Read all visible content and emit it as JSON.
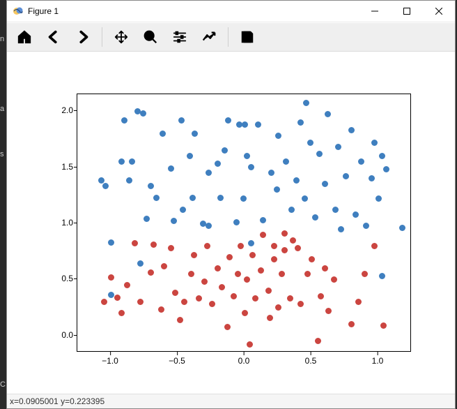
{
  "window": {
    "title": "Figure 1"
  },
  "toolbar": {
    "tools": [
      {
        "id": "home",
        "name": "home-icon"
      },
      {
        "id": "back",
        "name": "back-icon"
      },
      {
        "id": "forward",
        "name": "forward-icon"
      },
      {
        "sep": true
      },
      {
        "id": "pan",
        "name": "pan-icon"
      },
      {
        "id": "zoom",
        "name": "zoom-icon"
      },
      {
        "id": "config",
        "name": "sliders-icon"
      },
      {
        "id": "edit",
        "name": "line-chart-icon"
      },
      {
        "sep": true
      },
      {
        "id": "save",
        "name": "save-icon"
      }
    ]
  },
  "status": {
    "text": "x=0.0905001   y=0.223395"
  },
  "chart_data": {
    "type": "scatter",
    "xlim": [
      -1.25,
      1.25
    ],
    "ylim": [
      -0.15,
      2.15
    ],
    "xticks": [
      -1.0,
      -0.5,
      0.0,
      0.5,
      1.0
    ],
    "yticks": [
      0.0,
      0.5,
      1.0,
      1.5,
      2.0
    ],
    "xtick_labels": [
      "−1.0",
      "−0.5",
      "0.0",
      "0.5",
      "1.0"
    ],
    "ytick_labels": [
      "0.0",
      "0.5",
      "1.0",
      "1.5",
      "2.0"
    ],
    "series": [
      {
        "name": "blue",
        "color": "#3f7fbf",
        "points": [
          [
            -1.07,
            1.38
          ],
          [
            -1.04,
            1.33
          ],
          [
            -1.0,
            0.83
          ],
          [
            -1.0,
            0.36
          ],
          [
            -0.92,
            1.55
          ],
          [
            -0.9,
            1.92
          ],
          [
            -0.86,
            1.38
          ],
          [
            -0.84,
            1.55
          ],
          [
            -0.8,
            2.0
          ],
          [
            -0.78,
            0.64
          ],
          [
            -0.76,
            1.98
          ],
          [
            -0.73,
            1.04
          ],
          [
            -0.7,
            1.33
          ],
          [
            -0.66,
            1.23
          ],
          [
            -0.61,
            1.8
          ],
          [
            -0.55,
            1.49
          ],
          [
            -0.53,
            1.02
          ],
          [
            -0.47,
            1.92
          ],
          [
            -0.46,
            1.12
          ],
          [
            -0.41,
            1.6
          ],
          [
            -0.39,
            1.23
          ],
          [
            -0.37,
            1.8
          ],
          [
            -0.31,
            1.0
          ],
          [
            -0.27,
            1.45
          ],
          [
            -0.27,
            0.98
          ],
          [
            -0.2,
            1.53
          ],
          [
            -0.18,
            1.23
          ],
          [
            -0.15,
            1.65
          ],
          [
            -0.12,
            1.92
          ],
          [
            -0.06,
            1.01
          ],
          [
            -0.04,
            1.88
          ],
          [
            -0.01,
            1.22
          ],
          [
            0.0,
            1.88
          ],
          [
            0.02,
            1.6
          ],
          [
            0.05,
            1.5
          ],
          [
            0.05,
            0.82
          ],
          [
            0.1,
            1.88
          ],
          [
            0.14,
            1.03
          ],
          [
            0.2,
            1.45
          ],
          [
            0.24,
            1.3
          ],
          [
            0.25,
            1.78
          ],
          [
            0.31,
            1.55
          ],
          [
            0.35,
            1.12
          ],
          [
            0.39,
            1.38
          ],
          [
            0.42,
            1.9
          ],
          [
            0.45,
            1.22
          ],
          [
            0.46,
            2.07
          ],
          [
            0.49,
            1.72
          ],
          [
            0.53,
            1.05
          ],
          [
            0.56,
            1.62
          ],
          [
            0.6,
            1.35
          ],
          [
            0.62,
            1.97
          ],
          [
            0.68,
            1.12
          ],
          [
            0.7,
            1.68
          ],
          [
            0.72,
            0.95
          ],
          [
            0.76,
            1.42
          ],
          [
            0.8,
            1.83
          ],
          [
            0.83,
            1.08
          ],
          [
            0.87,
            1.55
          ],
          [
            0.91,
            0.98
          ],
          [
            0.95,
            1.4
          ],
          [
            0.97,
            1.72
          ],
          [
            1.0,
            1.22
          ],
          [
            1.03,
            0.53
          ],
          [
            1.03,
            1.6
          ],
          [
            1.06,
            1.48
          ],
          [
            1.18,
            0.96
          ]
        ]
      },
      {
        "name": "red",
        "color": "#cb4540",
        "points": [
          [
            -1.05,
            0.3
          ],
          [
            -1.0,
            0.52
          ],
          [
            -0.95,
            0.34
          ],
          [
            -0.92,
            0.2
          ],
          [
            -0.88,
            0.45
          ],
          [
            -0.82,
            0.82
          ],
          [
            -0.78,
            0.3
          ],
          [
            -0.7,
            0.56
          ],
          [
            -0.68,
            0.81
          ],
          [
            -0.62,
            0.23
          ],
          [
            -0.6,
            0.62
          ],
          [
            -0.55,
            0.78
          ],
          [
            -0.52,
            0.38
          ],
          [
            -0.48,
            0.14
          ],
          [
            -0.45,
            0.3
          ],
          [
            -0.4,
            0.55
          ],
          [
            -0.38,
            0.72
          ],
          [
            -0.34,
            0.33
          ],
          [
            -0.3,
            0.48
          ],
          [
            -0.28,
            0.8
          ],
          [
            -0.24,
            0.28
          ],
          [
            -0.2,
            0.6
          ],
          [
            -0.17,
            0.43
          ],
          [
            -0.13,
            0.08
          ],
          [
            -0.11,
            0.7
          ],
          [
            -0.08,
            0.35
          ],
          [
            -0.05,
            0.55
          ],
          [
            -0.03,
            0.8
          ],
          [
            0.0,
            0.2
          ],
          [
            0.02,
            0.5
          ],
          [
            0.04,
            -0.08
          ],
          [
            0.06,
            0.72
          ],
          [
            0.08,
            0.33
          ],
          [
            0.12,
            0.58
          ],
          [
            0.14,
            0.9
          ],
          [
            0.18,
            0.4
          ],
          [
            0.19,
            0.16
          ],
          [
            0.22,
            0.68
          ],
          [
            0.22,
            0.8
          ],
          [
            0.25,
            0.25
          ],
          [
            0.28,
            0.55
          ],
          [
            0.3,
            0.76
          ],
          [
            0.3,
            0.91
          ],
          [
            0.34,
            0.33
          ],
          [
            0.36,
            0.85
          ],
          [
            0.4,
            0.78
          ],
          [
            0.42,
            0.28
          ],
          [
            0.47,
            0.55
          ],
          [
            0.5,
            0.68
          ],
          [
            0.55,
            -0.05
          ],
          [
            0.57,
            0.35
          ],
          [
            0.6,
            0.6
          ],
          [
            0.63,
            0.22
          ],
          [
            0.67,
            0.5
          ],
          [
            0.8,
            0.1
          ],
          [
            0.85,
            0.3
          ],
          [
            0.9,
            0.55
          ],
          [
            0.97,
            0.8
          ],
          [
            1.04,
            0.09
          ]
        ]
      }
    ]
  }
}
